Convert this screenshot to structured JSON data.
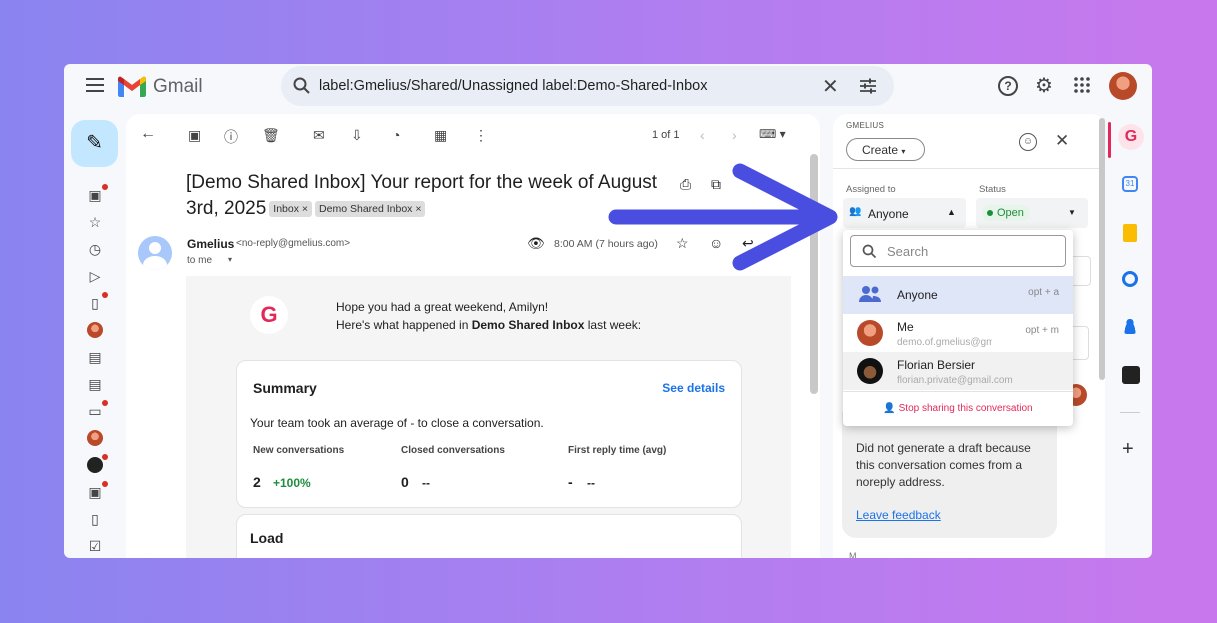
{
  "app": {
    "name": "Gmail"
  },
  "search": {
    "query": "label:Gmelius/Shared/Unassigned label:Demo-Shared-Inbox"
  },
  "toolbar": {
    "pager": "1 of 1"
  },
  "email": {
    "subject": "[Demo Shared Inbox] Your report for the week of August 3rd, 2025",
    "labels": [
      "Inbox ×",
      "Demo Shared Inbox ×"
    ],
    "sender_name": "Gmelius",
    "sender_email": "<no-reply@gmelius.com>",
    "to": "to me",
    "time": "8:00 AM (7 hours ago)",
    "greeting": "Hope you had a great weekend, Amilyn!",
    "intro_prefix": "Here's what happened in ",
    "intro_bold": "Demo Shared Inbox",
    "intro_suffix": " last week:",
    "summary": {
      "title": "Summary",
      "see_details": "See details",
      "text": "Your team took an average of - to close a conversation.",
      "stats": [
        {
          "label": "New conversations",
          "value": "2",
          "delta": "+100%"
        },
        {
          "label": "Closed conversations",
          "value": "0",
          "delta": "--"
        },
        {
          "label": "First reply time (avg)",
          "value": "-",
          "delta": "--"
        }
      ]
    },
    "load": {
      "title": "Load"
    }
  },
  "gmelius": {
    "brand": "GMELIUS",
    "create": "Create",
    "assigned_label": "Assigned to",
    "assigned_value": "Anyone",
    "status_label": "Status",
    "status_value": "Open",
    "dropdown": {
      "search_placeholder": "Search",
      "options": [
        {
          "label": "Anyone",
          "shortcut": "opt + a"
        },
        {
          "label": "Me",
          "email": "demo.of.gmelius@gmail...",
          "shortcut": "opt + m"
        },
        {
          "label": "Florian Bersier",
          "email": "florian.private@gmail.com"
        }
      ],
      "stop_sharing": "Stop sharing this conversation"
    },
    "draft_note": "Did not generate a draft because this conversation comes from a noreply address.",
    "feedback": "Leave feedback"
  },
  "colors": {
    "accent_blue": "#4a4ee0",
    "brand_red": "#e2285a",
    "status_green": "#1e8e3e",
    "link_blue": "#1a73e8"
  }
}
